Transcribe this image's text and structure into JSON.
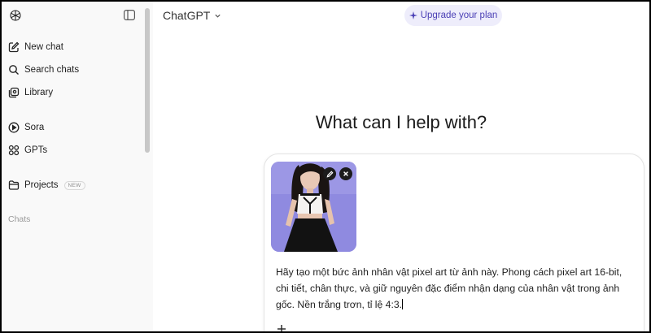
{
  "sidebar": {
    "items": [
      {
        "label": "New chat",
        "icon": "edit-icon"
      },
      {
        "label": "Search chats",
        "icon": "search-icon"
      },
      {
        "label": "Library",
        "icon": "library-icon"
      },
      {
        "label": "Sora",
        "icon": "play-circle-icon"
      },
      {
        "label": "GPTs",
        "icon": "grid-icon"
      },
      {
        "label": "Projects",
        "icon": "folder-icon",
        "badge": "NEW"
      }
    ],
    "section_label": "Chats"
  },
  "header": {
    "model_label": "ChatGPT",
    "upgrade_label": "Upgrade your plan"
  },
  "main": {
    "headline": "What can I help with?"
  },
  "composer": {
    "prompt": "Hãy tạo một bức ảnh nhân vật pixel art từ ảnh này. Phong cách pixel art 16-bit, chi tiết, chân thực, và giữ nguyên đặc điểm nhận dạng của nhân vật trong ảnh gốc. Nền trắng trơn, tỉ lệ 4:3."
  },
  "colors": {
    "sidebar_bg": "#f9f9f9",
    "accent": "#4a3fb5",
    "upgrade_bg": "#eeedfb"
  }
}
